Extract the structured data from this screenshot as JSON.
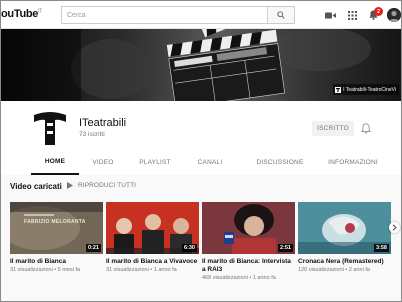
{
  "topbar": {
    "logo": "ouTube",
    "logo_sup": "IT",
    "search_placeholder": "Cerca",
    "notification_count": "2"
  },
  "banner": {
    "link_label": "I Teatrabili-TeatroCineVi"
  },
  "channel": {
    "name": "ITeatrabili",
    "subscribers": "73 iscritti",
    "subscribe_label": "ISCRITTO"
  },
  "tabs": [
    {
      "label": "HOME",
      "active": true
    },
    {
      "label": "VIDEO"
    },
    {
      "label": "PLAYLIST"
    },
    {
      "label": "CANALI"
    },
    {
      "label": "DISCUSSIONE"
    },
    {
      "label": "INFORMAZIONI"
    }
  ],
  "shelf": {
    "title": "Video caricati",
    "play_all": "RIPRODUCI TUTTI"
  },
  "videos": [
    {
      "title": "Il marito di Bianca",
      "meta": "31 visualizzazioni • 5 mesi fa",
      "duration": "0:21"
    },
    {
      "title": "Il marito di Bianca a Vivavoce",
      "meta": "31 visualizzazioni • 1 anno fa",
      "duration": "6:30"
    },
    {
      "title": "Il marito di Bianca: Intervista a RAI3",
      "meta": "468 visualizzazioni • 1 anno fa",
      "duration": "2:51"
    },
    {
      "title": "Cronaca Nera (Remastered)",
      "meta": "120 visualizzazioni • 2 anni fa",
      "duration": "3:58"
    }
  ],
  "thumb1_caption": "FABRIZIO MELORANTA",
  "icons": {
    "search": "search-icon",
    "upload": "video-camera-icon",
    "apps": "apps-grid-icon",
    "notifications": "bell-icon",
    "next": "chevron-right-icon",
    "play_all": "play-icon"
  }
}
